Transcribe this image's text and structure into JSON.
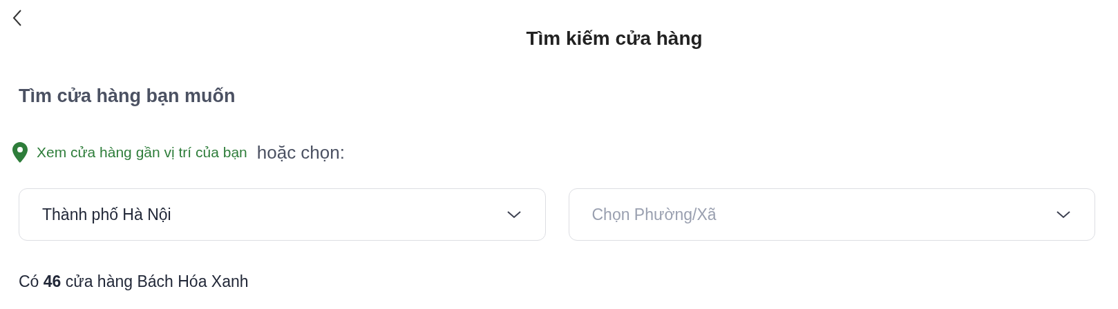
{
  "header": {
    "title": "Tìm kiếm cửa hàng"
  },
  "heading": "Tìm cửa hàng bạn muốn",
  "location": {
    "link": "Xem cửa hàng gần vị trí của bạn",
    "suffix": "hoặc chọn:"
  },
  "selects": [
    {
      "value": "Thành phố Hà Nội"
    },
    {
      "placeholder": "Chọn Phường/Xã"
    }
  ],
  "result": "Có **46** cửa hàng Bách Hóa Xanh"
}
